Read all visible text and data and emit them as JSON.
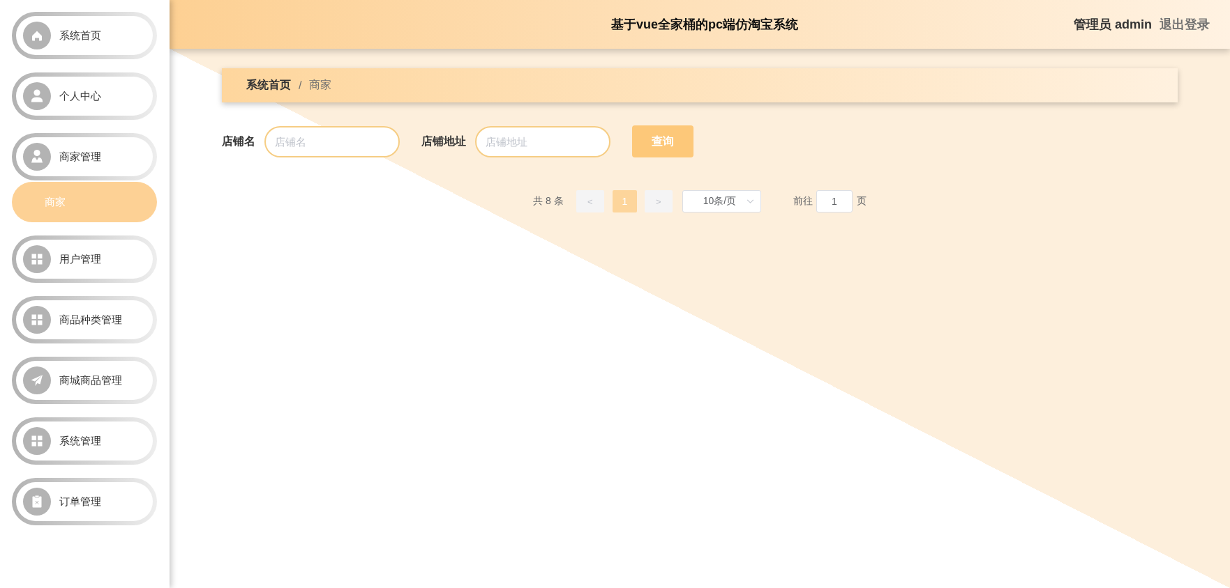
{
  "header": {
    "title": "基于vue全家桶的pc端仿淘宝系统",
    "user": "管理员 admin",
    "logout": "退出登录"
  },
  "sidebar": {
    "items": [
      {
        "label": "系统首页",
        "selected": false
      },
      {
        "label": "个人中心",
        "selected": false
      },
      {
        "label": "商家管理",
        "selected": false,
        "expanded": true,
        "children": [
          {
            "label": "商家",
            "selected": true
          }
        ]
      },
      {
        "label": "用户管理",
        "selected": false
      },
      {
        "label": "商品种类管理",
        "selected": false
      },
      {
        "label": "商城商品管理",
        "selected": false
      },
      {
        "label": "系统管理",
        "selected": false
      },
      {
        "label": "订单管理",
        "selected": false
      }
    ]
  },
  "breadcrumb": {
    "items": [
      "系统首页",
      "商家"
    ],
    "separator": "/"
  },
  "search": {
    "fields": [
      {
        "label": "店铺名",
        "placeholder": "店铺名"
      },
      {
        "label": "店铺地址",
        "placeholder": "店铺地址"
      }
    ],
    "button": "查询"
  },
  "pagination": {
    "total": "共 8 条",
    "prev": {
      "label": "<",
      "disabled": true
    },
    "pages": [
      {
        "label": "1",
        "selected": true
      }
    ],
    "next": {
      "label": ">",
      "disabled": true
    },
    "page_size": "10条/页",
    "goto_label": "前往",
    "goto_value": "1",
    "goto_suffix": "页"
  }
}
